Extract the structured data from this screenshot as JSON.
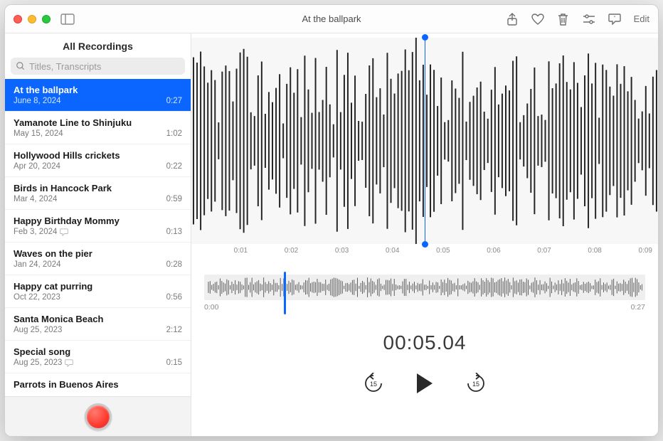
{
  "window": {
    "title": "At the ballpark",
    "edit_label": "Edit"
  },
  "sidebar": {
    "header": "All Recordings",
    "search_placeholder": "Titles, Transcripts",
    "items": [
      {
        "title": "At the ballpark",
        "date": "June 8, 2024",
        "duration": "0:27",
        "selected": true,
        "transcript": false
      },
      {
        "title": "Yamanote Line to Shinjuku",
        "date": "May 15, 2024",
        "duration": "1:02",
        "selected": false,
        "transcript": false
      },
      {
        "title": "Hollywood Hills crickets",
        "date": "Apr 20, 2024",
        "duration": "0:22",
        "selected": false,
        "transcript": false
      },
      {
        "title": "Birds in Hancock Park",
        "date": "Mar 4, 2024",
        "duration": "0:59",
        "selected": false,
        "transcript": false
      },
      {
        "title": "Happy Birthday Mommy",
        "date": "Feb 3, 2024",
        "duration": "0:13",
        "selected": false,
        "transcript": true
      },
      {
        "title": "Waves on the pier",
        "date": "Jan 24, 2024",
        "duration": "0:28",
        "selected": false,
        "transcript": false
      },
      {
        "title": "Happy cat purring",
        "date": "Oct 22, 2023",
        "duration": "0:56",
        "selected": false,
        "transcript": false
      },
      {
        "title": "Santa Monica Beach",
        "date": "Aug 25, 2023",
        "duration": "2:12",
        "selected": false,
        "transcript": false
      },
      {
        "title": "Special song",
        "date": "Aug 25, 2023",
        "duration": "0:15",
        "selected": false,
        "transcript": true
      },
      {
        "title": "Parrots in Buenos Aires",
        "date": "",
        "duration": "",
        "selected": false,
        "transcript": false
      }
    ]
  },
  "detail": {
    "axis": [
      "",
      "0:01",
      "0:02",
      "0:03",
      "0:04",
      "0:05",
      "0:06",
      "0:07",
      "0:08",
      "0:09"
    ],
    "overview_start": "0:00",
    "overview_end": "0:27",
    "timecode": "00:05.04",
    "skip_seconds": "15"
  },
  "colors": {
    "accent": "#0a66ff",
    "record": "#ff3b30"
  }
}
